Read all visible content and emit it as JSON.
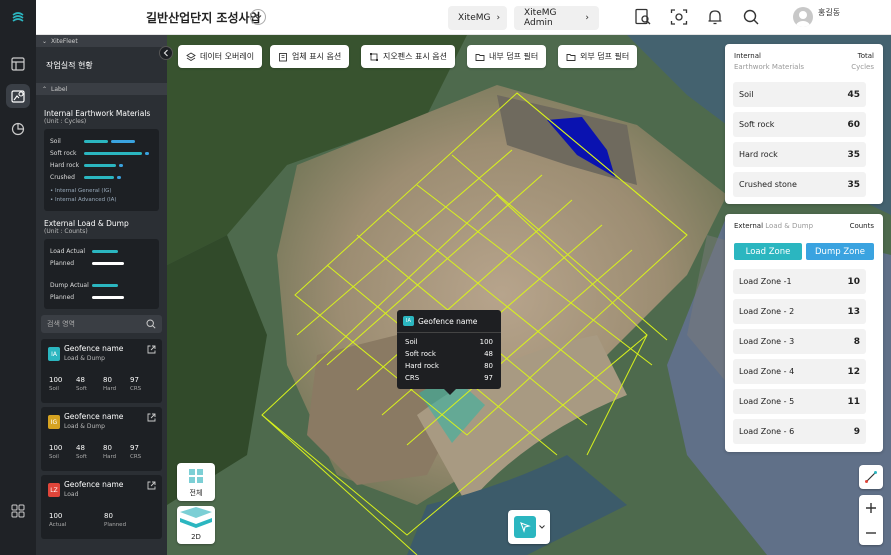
{
  "header": {
    "project_title": "길반산업단지 조성사업",
    "nav_buttons": [
      "XiteMG",
      "XiteMG Admin"
    ],
    "user_name": "홍길동"
  },
  "sidebar": {
    "section1": "XiteFleet",
    "work_status": "작업실적 현황",
    "section2": "Label",
    "internal_title": "Internal Earthwork Materials",
    "internal_unit": "(Unit : Cycles)",
    "internal_rows": [
      "Soil",
      "Soft rock",
      "Hard rock",
      "Crushed"
    ],
    "internal_legend": [
      "Internal General (IG)",
      "Internal Advanced (IA)"
    ],
    "external_title": "External Load & Dump",
    "external_unit": "(Unit : Counts)",
    "external_rows": [
      "Load Actual",
      "Planned",
      "Dump Actual",
      "Planned"
    ],
    "search_placeholder": "검색 영역",
    "geofences": [
      {
        "tag": "IA",
        "name": "Geofence name",
        "type": "Load & Dump",
        "values": [
          "100",
          "48",
          "80",
          "97"
        ],
        "labels": [
          "Soil",
          "Soft",
          "Hard",
          "CRS"
        ]
      },
      {
        "tag": "IG",
        "name": "Geofence name",
        "type": "Load & Dump",
        "values": [
          "100",
          "48",
          "80",
          "97"
        ],
        "labels": [
          "Soil",
          "Soft",
          "Hard",
          "CRS"
        ]
      },
      {
        "tag": "LZ",
        "name": "Geofence name",
        "type": "Load",
        "values": [
          "100",
          "80"
        ],
        "labels": [
          "Actual",
          "Planned"
        ]
      }
    ]
  },
  "toolbar": [
    "데이터 오버레이",
    "업체 표시 옵션",
    "지오펜스 표시 옵션",
    "내부 덤프 필터",
    "외부 덤프 필터"
  ],
  "tooltip": {
    "badge": "IA",
    "name": "Geofence name",
    "rows": [
      {
        "label": "Soil",
        "value": "100"
      },
      {
        "label": "Soft rock",
        "value": "48"
      },
      {
        "label": "Hard rock",
        "value": "80"
      },
      {
        "label": "CRS",
        "value": "97"
      }
    ]
  },
  "internal_card": {
    "title": "Internal",
    "subtitle": "Earthwork Materials",
    "total": "Total",
    "cycles": "Cycles",
    "rows": [
      {
        "label": "Soil",
        "value": "45"
      },
      {
        "label": "Soft rock",
        "value": "60"
      },
      {
        "label": "Hard rock",
        "value": "35"
      },
      {
        "label": "Crushed stone",
        "value": "35"
      }
    ]
  },
  "external_card": {
    "title": "External",
    "subtitle": "Load & Dump",
    "counts": "Counts",
    "load_zone": "Load Zone",
    "dump_zone": "Dump Zone",
    "rows": [
      {
        "label": "Load Zone -1",
        "value": "10"
      },
      {
        "label": "Load Zone - 2",
        "value": "13"
      },
      {
        "label": "Load Zone - 3",
        "value": "8"
      },
      {
        "label": "Load Zone - 4",
        "value": "12"
      },
      {
        "label": "Load Zone - 5",
        "value": "11"
      },
      {
        "label": "Load Zone - 6",
        "value": "9"
      }
    ]
  },
  "view": {
    "all": "전체",
    "dim": "2D"
  },
  "colors": {
    "accent": "#2bb6c0",
    "dump": "#3aa3e0",
    "panel": "#2b2f34",
    "geofence": "#d8f21c"
  }
}
